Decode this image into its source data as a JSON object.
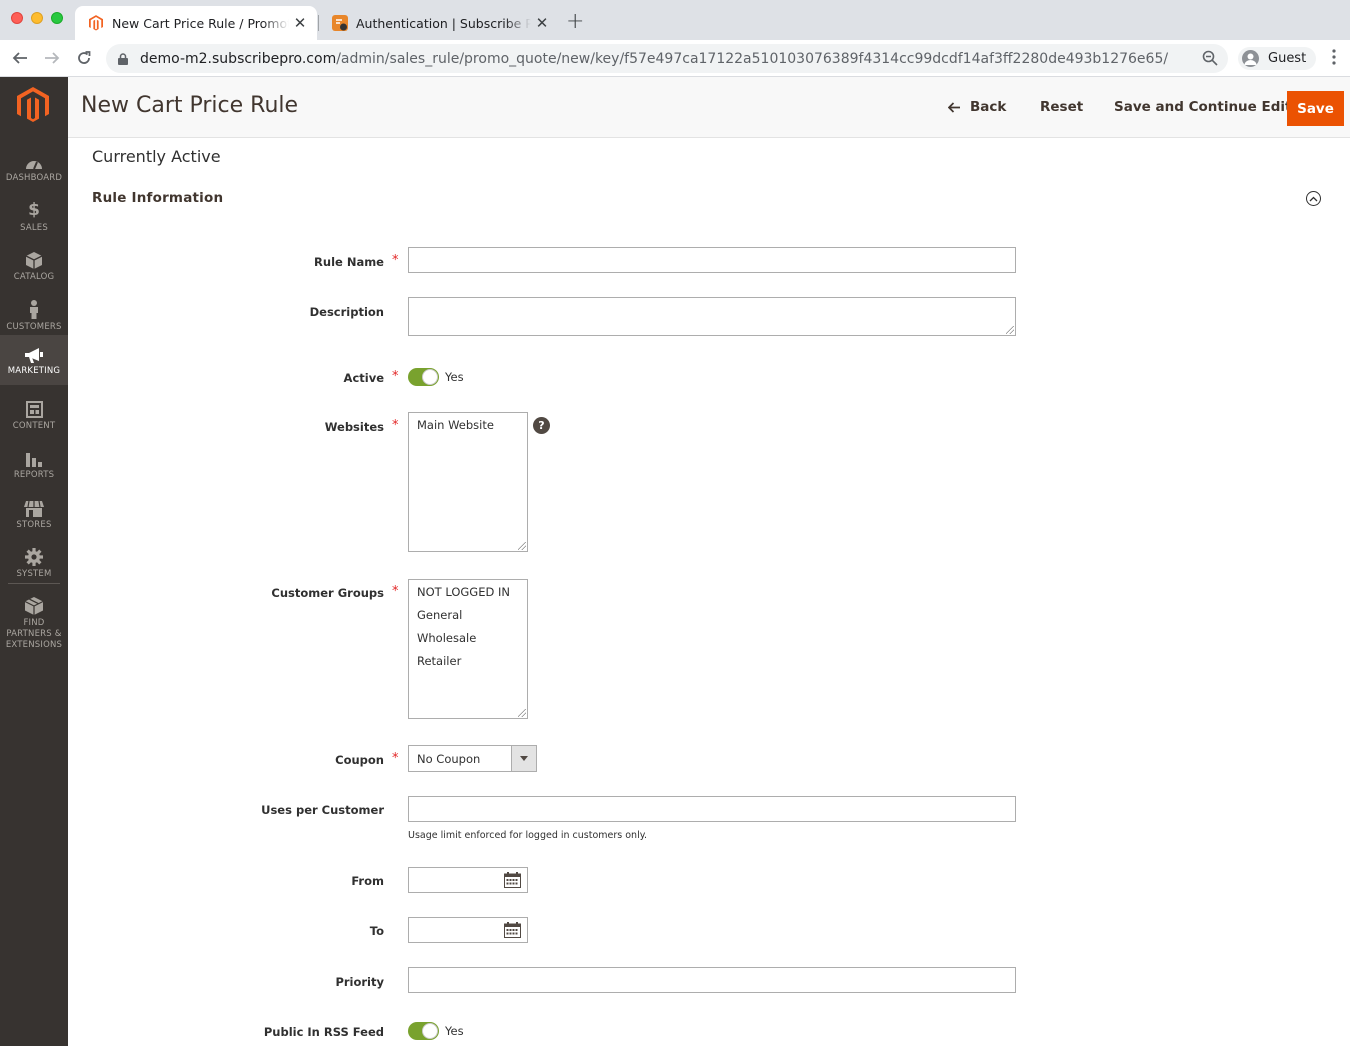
{
  "browser": {
    "tabs": [
      {
        "title": "New Cart Price Rule / Promotio",
        "active": true
      },
      {
        "title": "Authentication | Subscribe Pro",
        "active": false
      }
    ],
    "close_glyph": "✕",
    "new_tab_glyph": "+",
    "url_host": "demo-m2.subscribepro.com",
    "url_path": "/admin/sales_rule/promo_quote/new/key/f57e497ca17122a510103076389f4314cc99dcdf14af3ff2280de493b1276e65/",
    "profile_label": "Guest"
  },
  "sidebar": {
    "items": [
      {
        "label": "DASHBOARD",
        "icon": "dashboard-icon"
      },
      {
        "label": "SALES",
        "icon": "dollar-icon"
      },
      {
        "label": "CATALOG",
        "icon": "box-icon"
      },
      {
        "label": "CUSTOMERS",
        "icon": "person-icon"
      },
      {
        "label": "MARKETING",
        "icon": "megaphone-icon",
        "active": true
      },
      {
        "label": "CONTENT",
        "icon": "layout-icon"
      },
      {
        "label": "REPORTS",
        "icon": "bar-chart-icon"
      },
      {
        "label": "STORES",
        "icon": "storefront-icon"
      },
      {
        "label": "SYSTEM",
        "icon": "gear-icon"
      },
      {
        "label_lines": [
          "FIND",
          "PARTNERS &",
          "EXTENSIONS"
        ],
        "icon": "extensions-box-icon"
      }
    ]
  },
  "header": {
    "title": "New Cart Price Rule",
    "back_label": "Back",
    "reset_label": "Reset",
    "save_continue_label": "Save and Continue Edit",
    "save_label": "Save"
  },
  "main": {
    "status": "Currently Active",
    "section_title": "Rule Information",
    "fields": {
      "rule_name": {
        "label": "Rule Name",
        "value": ""
      },
      "description": {
        "label": "Description",
        "value": ""
      },
      "active": {
        "label": "Active",
        "toggle_text": "Yes",
        "on": true
      },
      "websites": {
        "label": "Websites",
        "options": [
          "Main Website"
        ]
      },
      "customer_groups": {
        "label": "Customer Groups",
        "options": [
          "NOT LOGGED IN",
          "General",
          "Wholesale",
          "Retailer"
        ]
      },
      "coupon": {
        "label": "Coupon",
        "value": "No Coupon"
      },
      "uses_per_customer": {
        "label": "Uses per Customer",
        "value": "",
        "note": "Usage limit enforced for logged in customers only."
      },
      "from": {
        "label": "From",
        "value": ""
      },
      "to": {
        "label": "To",
        "value": ""
      },
      "priority": {
        "label": "Priority",
        "value": ""
      },
      "public_rss": {
        "label": "Public In RSS Feed",
        "toggle_text": "Yes",
        "on": true
      }
    },
    "required_marker": "*",
    "help_glyph": "?"
  },
  "colors": {
    "accent": "#eb5202",
    "sidebar_bg": "#373330",
    "toggle_on": "#79a22e",
    "required": "#e22626"
  }
}
